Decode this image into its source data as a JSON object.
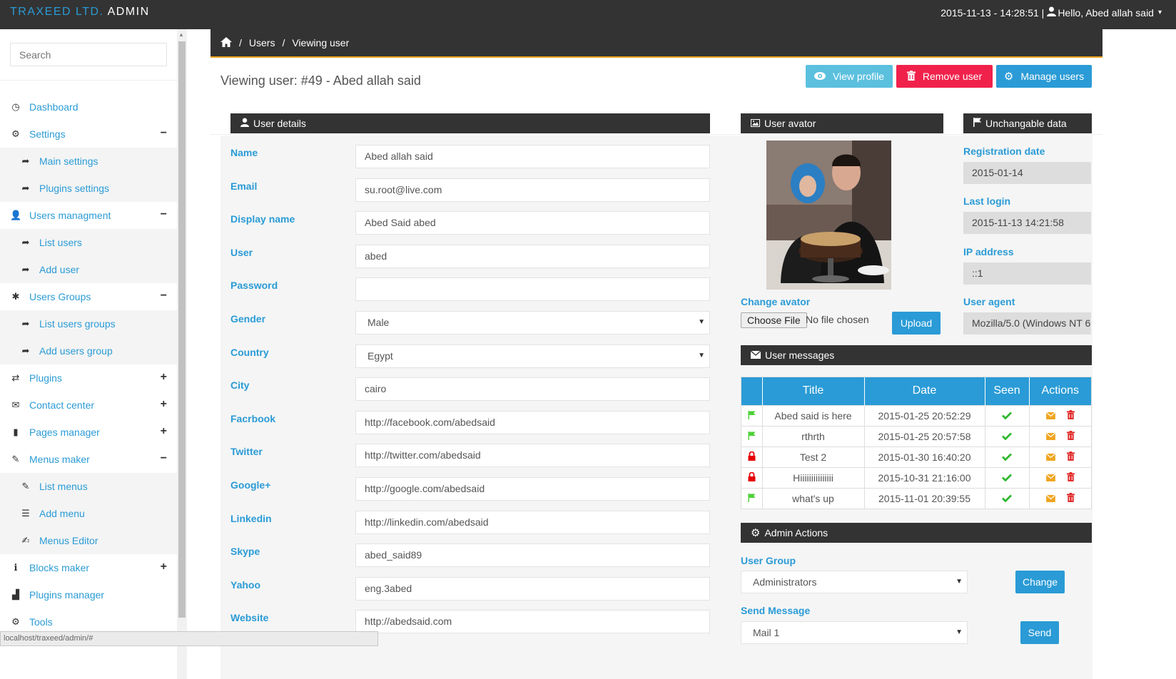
{
  "brand": {
    "part1": "TRAXEED LTD.",
    "part2": "ADMIN"
  },
  "topbar": {
    "datetime": "2015-11-13 - 14:28:51 |",
    "user_icon": "user-icon",
    "greeting": "Hello, Abed allah said",
    "caret": "▾"
  },
  "sidebar": {
    "search_placeholder": "Search",
    "items": [
      {
        "label": "Dashboard",
        "icon": "dashboard-icon",
        "glyph": "◷",
        "level": "top",
        "toggle": ""
      },
      {
        "label": "Settings",
        "icon": "gear-icon",
        "glyph": "⚙",
        "level": "top",
        "toggle": "−"
      },
      {
        "label": "Main settings",
        "icon": "share-icon",
        "glyph": "➦",
        "level": "sub",
        "toggle": ""
      },
      {
        "label": "Plugins settings",
        "icon": "share-icon",
        "glyph": "➦",
        "level": "sub",
        "toggle": ""
      },
      {
        "label": "Users managment",
        "icon": "user-icon",
        "glyph": "👤",
        "level": "top",
        "toggle": "−"
      },
      {
        "label": "List users",
        "icon": "share-icon",
        "glyph": "➦",
        "level": "sub",
        "toggle": ""
      },
      {
        "label": "Add user",
        "icon": "share-icon",
        "glyph": "➦",
        "level": "sub",
        "toggle": ""
      },
      {
        "label": "Users Groups",
        "icon": "asterisk-icon",
        "glyph": "✱",
        "level": "top",
        "toggle": "−"
      },
      {
        "label": "List users groups",
        "icon": "share-icon",
        "glyph": "➦",
        "level": "sub",
        "toggle": ""
      },
      {
        "label": "Add users group",
        "icon": "share-icon",
        "glyph": "➦",
        "level": "sub",
        "toggle": ""
      },
      {
        "label": "Plugins",
        "icon": "retweet-icon",
        "glyph": "⇄",
        "level": "top",
        "toggle": "+"
      },
      {
        "label": "Contact center",
        "icon": "envelope-icon",
        "glyph": "✉",
        "level": "top",
        "toggle": "+"
      },
      {
        "label": "Pages manager",
        "icon": "file-icon",
        "glyph": "▮",
        "level": "top",
        "toggle": "+"
      },
      {
        "label": "Menus maker",
        "icon": "pencil-icon",
        "glyph": "✎",
        "level": "top",
        "toggle": "−"
      },
      {
        "label": "List menus",
        "icon": "pencil-icon",
        "glyph": "✎",
        "level": "sub",
        "toggle": ""
      },
      {
        "label": "Add menu",
        "icon": "list-icon",
        "glyph": "☰",
        "level": "sub",
        "toggle": ""
      },
      {
        "label": "Menus Editor",
        "icon": "edit-icon",
        "glyph": "✍",
        "level": "sub",
        "toggle": ""
      },
      {
        "label": "Blocks maker",
        "icon": "info-icon",
        "glyph": "ℹ",
        "level": "top",
        "toggle": "+"
      },
      {
        "label": "Plugins manager",
        "icon": "stats-icon",
        "glyph": "▟",
        "level": "top",
        "toggle": ""
      },
      {
        "label": "Tools",
        "icon": "gear-icon",
        "glyph": "⚙",
        "level": "top",
        "toggle": ""
      }
    ]
  },
  "statusbar": "localhost/traxeed/admin/#",
  "breadcrumb": {
    "home_icon": "home-icon",
    "sep": "/",
    "items": [
      "Users",
      "Viewing user"
    ]
  },
  "page": {
    "title": "Viewing user: #49 - Abed allah said"
  },
  "actions": {
    "view_profile": "View profile",
    "remove_user": "Remove user",
    "manage_users": "Manage users"
  },
  "user_details": {
    "heading": "User details",
    "fields": [
      {
        "label": "Name",
        "value": "Abed allah said",
        "type": "text"
      },
      {
        "label": "Email",
        "value": "su.root@live.com",
        "type": "text"
      },
      {
        "label": "Display name",
        "value": "Abed Said abed",
        "type": "text"
      },
      {
        "label": "User",
        "value": "abed",
        "type": "text"
      },
      {
        "label": "Password",
        "value": "",
        "type": "password"
      },
      {
        "label": "Gender",
        "value": "Male",
        "type": "select"
      },
      {
        "label": "Country",
        "value": "Egypt",
        "type": "select"
      },
      {
        "label": "City",
        "value": "cairo",
        "type": "text"
      },
      {
        "label": "Facrbook",
        "value": "http://facebook.com/abedsaid",
        "type": "text"
      },
      {
        "label": "Twitter",
        "value": "http://twitter.com/abedsaid",
        "type": "text"
      },
      {
        "label": "Google+",
        "value": "http://google.com/abedsaid",
        "type": "text"
      },
      {
        "label": "Linkedin",
        "value": "http://linkedin.com/abedsaid",
        "type": "text"
      },
      {
        "label": "Skype",
        "value": "abed_said89",
        "type": "text"
      },
      {
        "label": "Yahoo",
        "value": "eng.3abed",
        "type": "text"
      },
      {
        "label": "Website",
        "value": "http://abedsaid.com",
        "type": "text"
      }
    ]
  },
  "avatar": {
    "heading": "User avator",
    "change_label": "Change avator",
    "choose_file": "Choose File",
    "no_file": "No file chosen",
    "upload": "Upload"
  },
  "unchangeable": {
    "heading": "Unchangable data",
    "fields": [
      {
        "label": "Registration date",
        "value": "2015-01-14"
      },
      {
        "label": "Last login",
        "value": "2015-11-13 14:21:58"
      },
      {
        "label": "IP address",
        "value": "::1"
      },
      {
        "label": "User agent",
        "value": "Mozilla/5.0 (Windows NT 6"
      }
    ]
  },
  "messages": {
    "heading": "User messages",
    "columns": [
      "",
      "Title",
      "Date",
      "Seen",
      "Actions"
    ],
    "rows": [
      {
        "status": "flag",
        "title": "Abed said is here",
        "date": "2015-01-25 20:52:29"
      },
      {
        "status": "flag",
        "title": "rthrth",
        "date": "2015-01-25 20:57:58"
      },
      {
        "status": "lock",
        "title": "Test 2",
        "date": "2015-01-30 16:40:20"
      },
      {
        "status": "lock",
        "title": "Hiiiiiiiiiiiiiii",
        "date": "2015-10-31 21:16:00"
      },
      {
        "status": "flag",
        "title": "what's up",
        "date": "2015-11-01 20:39:55"
      }
    ]
  },
  "admin_actions": {
    "heading": "Admin Actions",
    "group_label": "User Group",
    "group_value": "Administrators",
    "change_button": "Change",
    "message_label": "Send Message",
    "message_value": "Mail 1",
    "send_button": "Send"
  },
  "colors": {
    "accent": "#2a9bd6",
    "dark": "#333333",
    "danger": "#f0224b",
    "info": "#5bc0de",
    "orange": "#f0a520"
  }
}
